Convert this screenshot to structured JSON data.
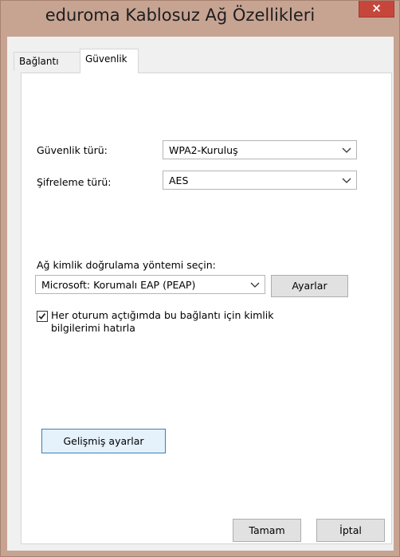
{
  "window": {
    "title": "eduroma Kablosuz Ağ Özellikleri",
    "close_glyph": "×"
  },
  "tabs": [
    {
      "label": "Bağlantı",
      "active": false
    },
    {
      "label": "Güvenlik",
      "active": true
    }
  ],
  "security": {
    "security_type_label": "Güvenlik türü:",
    "security_type_value": "WPA2-Kuruluş",
    "encryption_type_label": "Şifreleme türü:",
    "encryption_type_value": "AES"
  },
  "auth": {
    "method_label": "Ağ kimlik doğrulama yöntemi seçin:",
    "method_value": "Microsoft: Korumalı EAP (PEAP)",
    "settings_button": "Ayarlar",
    "remember_checkbox_line1": "Her oturum açtığımda bu bağlantı için kimlik",
    "remember_checkbox_line2": "bilgilerimi hatırla",
    "remember_checked": true
  },
  "advanced_button": "Gelişmiş ayarlar",
  "footer": {
    "ok_button": "Tamam",
    "cancel_button": "İptal"
  },
  "icons": {
    "close": "close-icon",
    "dropdown": "chevron-down-icon",
    "check": "checkmark-icon"
  },
  "colors": {
    "frame": "#c7a392",
    "close_button": "#c7463c",
    "advanced_button_border": "#3c7fb1"
  }
}
